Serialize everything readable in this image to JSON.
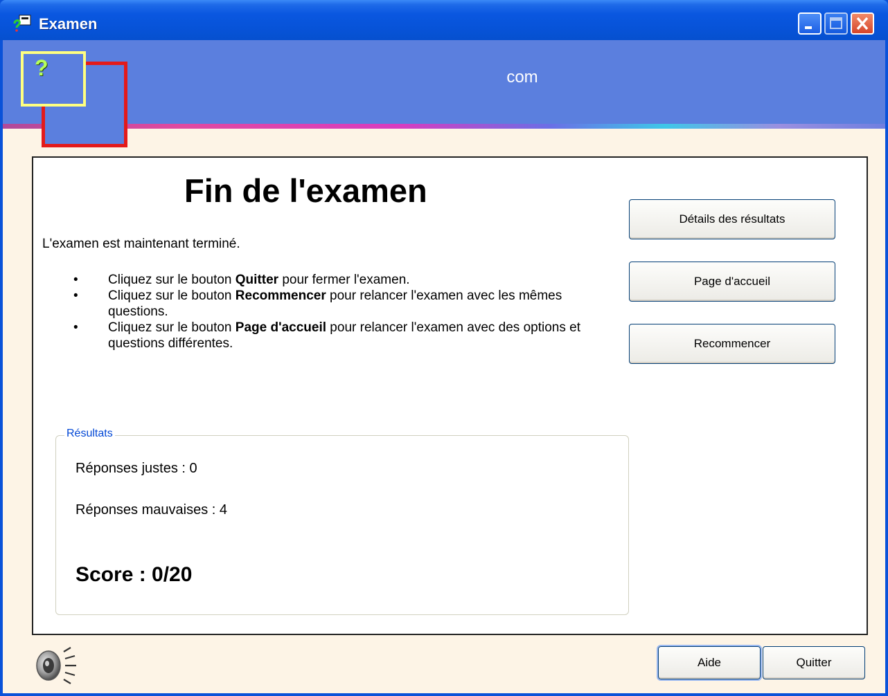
{
  "window": {
    "title": "Examen"
  },
  "header": {
    "title": "com",
    "logo_glyph": "?"
  },
  "main": {
    "title": "Fin de l'examen",
    "intro": "L'examen est maintenant terminé.",
    "bullets": [
      {
        "pre": "Cliquez sur le bouton ",
        "bold": "Quitter",
        "post": " pour fermer l'examen."
      },
      {
        "pre": "Cliquez sur le bouton ",
        "bold": "Recommencer",
        "post": " pour relancer l'examen avec les mêmes questions."
      },
      {
        "pre": "Cliquez sur le bouton ",
        "bold": "Page d'accueil",
        "post": " pour relancer l'examen avec des options et questions différentes."
      }
    ],
    "bullet_glyph": "•"
  },
  "side_buttons": {
    "details": "Détails des résultats",
    "home": "Page d'accueil",
    "restart": "Recommencer"
  },
  "results": {
    "legend": "Résultats",
    "correct": "Réponses justes :  0",
    "wrong": "Réponses mauvaises :  4",
    "score": "Score :  0/20"
  },
  "footer": {
    "help_label": "Aide",
    "quit_label": "Quitter",
    "speaker_icon": "speaker-icon"
  },
  "colors": {
    "title_bar": "#0a57e0",
    "header_band": "#5b7fde",
    "client_background": "#fdf4e6",
    "results_legend": "#0046d5"
  }
}
